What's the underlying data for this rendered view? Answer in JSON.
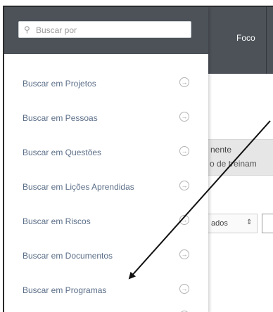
{
  "topbar": {
    "tab_label": "Foco"
  },
  "search": {
    "placeholder": "Buscar por",
    "icon": "search-icon"
  },
  "menu": {
    "items": [
      {
        "label": "Buscar em Projetos",
        "icon": "arrow-right-circle-icon"
      },
      {
        "label": "Buscar em Pessoas",
        "icon": "arrow-right-circle-icon"
      },
      {
        "label": "Buscar em Questões",
        "icon": "arrow-right-circle-icon"
      },
      {
        "label": "Buscar em Lições Aprendidas",
        "icon": "arrow-right-circle-icon"
      },
      {
        "label": "Buscar em Riscos",
        "icon": "arrow-right-circle-icon"
      },
      {
        "label": "Buscar em Documentos",
        "icon": "arrow-right-circle-icon"
      },
      {
        "label": "Buscar em Programas",
        "icon": "arrow-right-circle-icon"
      }
    ]
  },
  "background": {
    "band_line1": "nente",
    "band_line2": "o de treinam",
    "filter_label": "ados"
  },
  "colors": {
    "topbar": "#4c5258",
    "menu_text": "#5b6e88",
    "annotation": "#111111"
  }
}
